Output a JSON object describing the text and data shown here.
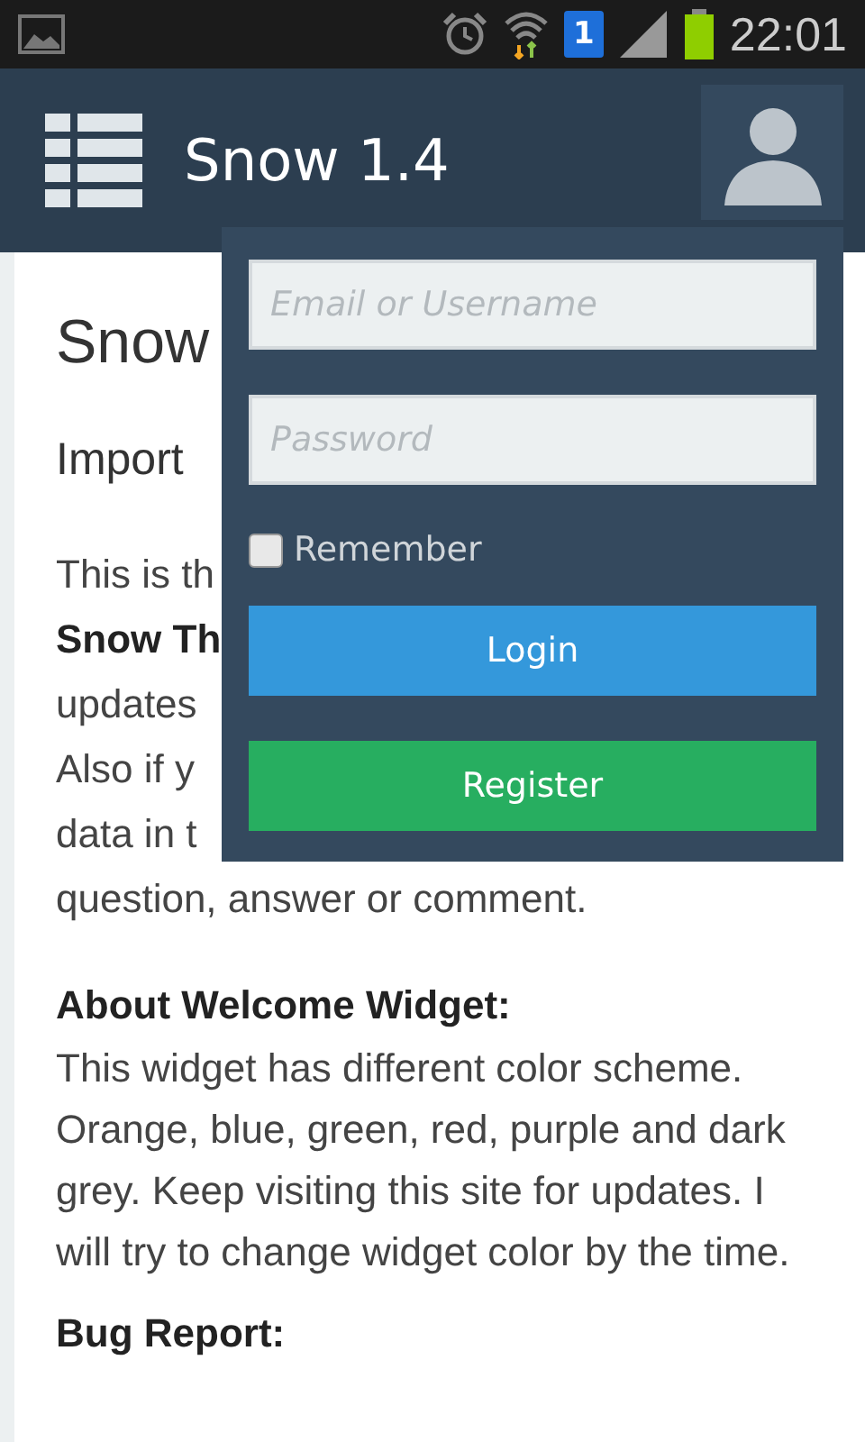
{
  "status_bar": {
    "sim": "1",
    "time": "22:01"
  },
  "header": {
    "title": "Snow 1.4"
  },
  "article": {
    "title": "Snow",
    "subtitle": "Import",
    "intro_lines": [
      {
        "text": "This is th",
        "bold": false
      },
      {
        "text": "Snow Th",
        "bold": true
      },
      {
        "text": "updates",
        "bold": false
      },
      {
        "text": "Also if y",
        "bold": false
      },
      {
        "text": "data in t",
        "bold": false
      },
      {
        "text": "question, answer or comment.",
        "bold": false
      }
    ],
    "sections": [
      {
        "heading": "About Welcome Widget:",
        "body": "This widget has different color scheme. Orange, blue, green, red, purple and dark grey. Keep visiting this site for updates. I will try to change widget color by the time."
      },
      {
        "heading": "Bug Report:"
      }
    ]
  },
  "login": {
    "email_placeholder": "Email or Username",
    "password_placeholder": "Password",
    "remember": {
      "label": "Remember",
      "checked": false
    },
    "buttons": [
      {
        "label": "Login",
        "kind": "primary"
      },
      {
        "label": "Register",
        "kind": "success"
      }
    ]
  }
}
